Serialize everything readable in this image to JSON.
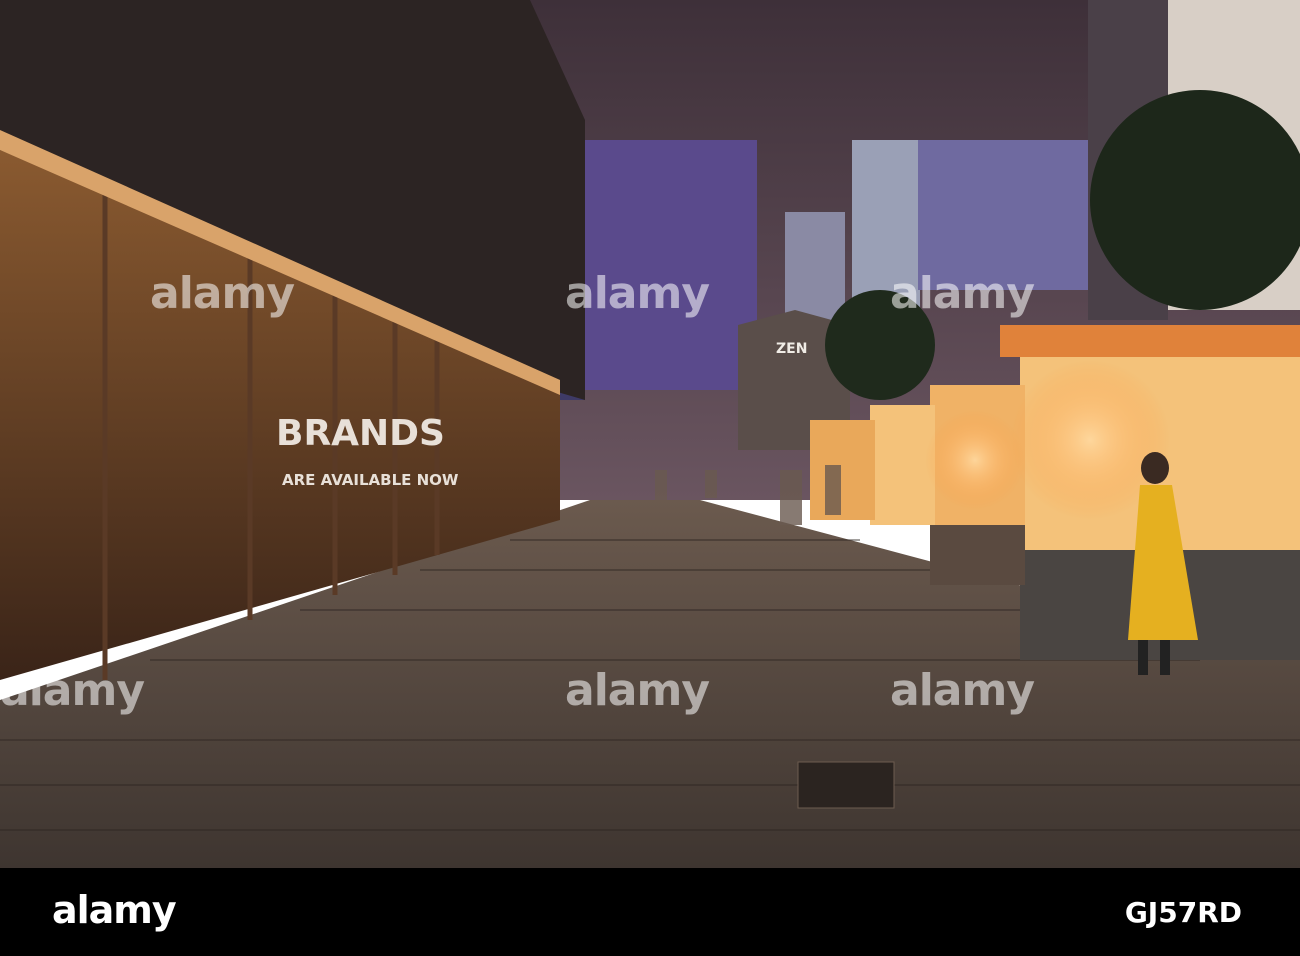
{
  "photo": {
    "scene": "night pedestrian street with shop windows and kiosks",
    "signs": {
      "zen": "ZEN",
      "brands_line1": "BRANDS",
      "brands_line2": "ARE AVAILABLE NOW"
    },
    "watermarks": [
      "alamy",
      "alamy",
      "alamy",
      "alamy",
      "alamy",
      "alamy"
    ]
  },
  "strip": {
    "logo": "alamy",
    "image_id": "GJ57RD"
  },
  "colors": {
    "sky": "#4a3a44",
    "pavement": "#5c4c42",
    "tower_purple": "#5a4a8c",
    "kiosk_glow": "#ffb45a"
  }
}
